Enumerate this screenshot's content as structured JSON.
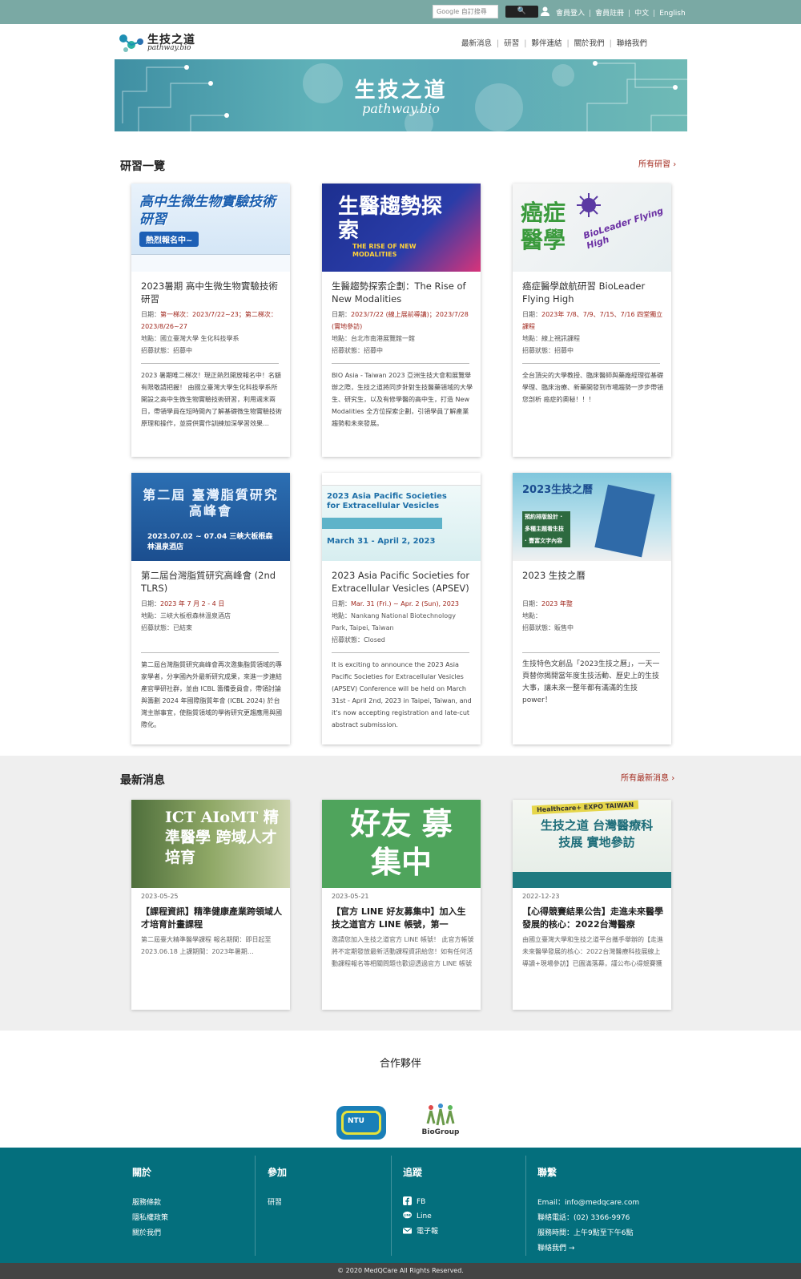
{
  "topbar": {
    "search_placeholder": "Google 自訂搜尋",
    "search_button": "🔍",
    "links": [
      "會員登入",
      "會員註冊",
      "中文",
      "English"
    ]
  },
  "header": {
    "logo_text": "生技之道",
    "logo_sub": "pathway.bio",
    "nav": [
      "最新消息",
      "研習",
      "夥伴連結",
      "關於我們",
      "聯絡我們"
    ]
  },
  "banner": {
    "title": "生技之道",
    "subtitle": "pathway.bio"
  },
  "workshops": {
    "title": "研習一覽",
    "more": "所有研習",
    "items": [
      {
        "img_text": "高中生微生物實驗技術研習",
        "img_badge": "熱烈報名中~",
        "title": "2023暑期 高中生微生物實驗技術研習",
        "date_label": "日期：",
        "date": "第一梯次：2023/7/22~23；第二梯次：2023/8/26~27",
        "loc": "地點：國立臺灣大學 生化科技學系",
        "status": "招募狀態：招募中",
        "desc": "2023 暑期唯二梯次！現正熱烈開放報名中！名額有限敬請把握！ 由國立臺灣大學生化科技學系所開設之高中生微生物實驗技術研習，利用週末兩日，帶領學員在短時間內了解基礎微生物實驗技術原理和操作，並提供實作訓練加深學習效果…"
      },
      {
        "img_text": "生醫趨勢探索",
        "img_badge": "THE RISE OF NEW MODALITIES",
        "title": "生醫趨勢探索企劃：The Rise of New Modalities",
        "date_label": "日期：",
        "date": "2023/7/22 (線上展前導講)；2023/7/28 (實地參訪)",
        "loc": "地點：台北市南港展覽館一館",
        "status": "招募狀態：招募中",
        "desc": "BIO Asia - Taiwan 2023 亞洲生技大會和展覽舉辦之際，生技之道將同步針對生技醫藥領域的大學生、研究生，以及有修學醫的高中生，打造 New Modalities 全方位探索企劃，引領學員了解產業趨勢和未來發展。"
      },
      {
        "img_text": "癌症醫學",
        "img_badge": "BioLeader Flying High",
        "title": "癌症醫學啟航研習 BioLeader Flying High",
        "date_label": "日期：",
        "date": "2023年 7/8、7/9、7/15、7/16 四堂獨立課程",
        "loc": "地點：線上視訊課程",
        "status": "招募狀態：招募中",
        "desc": "全台頂尖的大學教授、臨床醫師與藥廠經理從基礎學理、臨床治療、新藥開發到市場趨勢一步步帶領您剖析 癌症的奧秘！！！"
      },
      {
        "img_text": "第二屆 臺灣脂質研究高峰會",
        "img_badge": "2023.07.02 ~ 07.04 三峽大板根森林溫泉酒店",
        "title": "第二屆台灣脂質研究高峰會 (2nd TLRS)",
        "date_label": "日期：",
        "date": "2023 年 7 月 2 - 4 日",
        "loc": "地點：三峽大板根森林溫泉酒店",
        "status": "招募狀態：已結束",
        "desc": "第二屆台灣脂質研究高峰會再次邀集脂質領域的專家學者，分享國內外最新研究成果，來進一步連結產官學研社群，並由 ICBL 籌備委員會，帶領討論與籌劃 2024 年國際脂質年會 (ICBL 2024) 於台灣主辦事宜，使脂質領域的學術研究更趨應用與國際化。"
      },
      {
        "img_text": "2023 Asia Pacific Societies for Extracellular Vesicles",
        "img_badge": "March 31 - April 2, 2023",
        "title": "2023 Asia Pacific Societies for Extracellular Vesicles (APSEV)",
        "date_label": "日期：",
        "date": "Mar. 31 (Fri.) ~ Apr. 2 (Sun), 2023",
        "loc": "地點：Nankang National Biotechnology Park, Taipei, Taiwan",
        "status": "招募狀態：Closed",
        "desc": "It is exciting to announce the 2023 Asia Pacific Societies for Extracellular Vesicles (APSEV) Conference will be held on March 31st - April 2nd, 2023 in Taipei, Taiwan, and it's now accepting registration and late-cut abstract submission."
      },
      {
        "img_text": "2023生技之曆",
        "img_badge": "預約排版設計 · 多種主題看生技 · 豐富文字內容",
        "title": "2023 生技之曆",
        "date_label": "日期：",
        "date": "2023 年整",
        "loc": "地點：",
        "status": "招募狀態：販售中",
        "desc": "生技特色文創品「2023生技之曆」，一天一頁替你揭開當年度生技活動、歷史上的生技大事，讓未來一整年都有滿滿的生技power！"
      }
    ]
  },
  "news": {
    "title": "最新消息",
    "more": "所有最新消息",
    "items": [
      {
        "img_text": "ICT AIoMT 精準醫學 跨域人才培育",
        "date": "2023-05-25",
        "title": "【課程資訊】精準健康產業跨領域人才培育計畫課程",
        "excerpt": "第二屆臺大精準醫學課程 報名期間：即日起至2023.06.18 上課期間：2023年暑期…"
      },
      {
        "img_text": "好友 募集中",
        "date": "2023-05-21",
        "title": "【官方 LINE 好友募集中】加入生技之道官方 LINE 帳號，第一",
        "excerpt": "邀請您加入生技之道官方 LINE 帳號！ 此官方帳號將不定期發放最新活動課程資訊給您！如有任何活動課程報名等相關問題也歡迎透過官方 LINE 帳號或 email…"
      },
      {
        "img_text": "生技之道 台灣醫療科技展 實地參訪",
        "img_badge": "Healthcare+ EXPO TAIWAN",
        "date": "2022-12-23",
        "title": "【心得競賽結果公告】走進未來醫學發展的核心：2022台灣醫療",
        "excerpt": "由國立臺灣大學和生技之道平台攜手舉辦的【走進未來醫學發展的核心：2022台灣醫療科技展線上導讀+現場參訪】已圓滿落幕，謹公布心得競賽獲獎名單。…"
      }
    ]
  },
  "partners": {
    "title": "合作夥伴",
    "items": [
      "NTU",
      "BioGroup"
    ]
  },
  "footer": {
    "about": {
      "title": "關於",
      "links": [
        "服務條款",
        "隱私權政策",
        "關於我們"
      ]
    },
    "join": {
      "title": "參加",
      "links": [
        "研習"
      ]
    },
    "follow": {
      "title": "追蹤",
      "links": [
        "FB",
        "Line",
        "電子報"
      ]
    },
    "contact": {
      "title": "聯繫",
      "email": "Email：info@medqcare.com",
      "phone": "聯絡電話：(02) 3366-9976",
      "hours": "服務時間：上午9點至下午6點",
      "link": "聯絡我們 →"
    },
    "copyright": "© 2020 MedQCare All Rights Reserved."
  },
  "colors": {
    "topbar": "#7aa9a4",
    "footer": "#046f7d",
    "accent_red": "#a32a1e"
  }
}
